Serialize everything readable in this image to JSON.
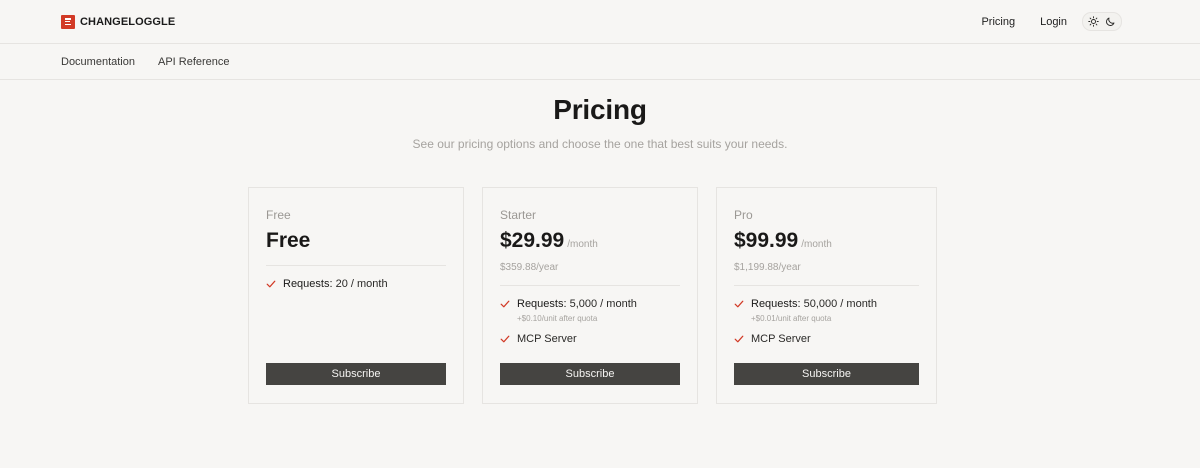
{
  "brand": {
    "name": "CHANGELOGGLE",
    "logo_color": "#d23a26"
  },
  "topnav": {
    "pricing": "Pricing",
    "login": "Login"
  },
  "subnav": {
    "documentation": "Documentation",
    "api_reference": "API Reference"
  },
  "hero": {
    "title": "Pricing",
    "subtitle": "See our pricing options and choose the one that best suits your needs."
  },
  "plans": [
    {
      "name": "Free",
      "price": "Free",
      "per": "",
      "year": "",
      "features": [
        {
          "label": "Requests:",
          "value": "20 / month",
          "note": ""
        }
      ],
      "cta": "Subscribe"
    },
    {
      "name": "Starter",
      "price": "$29.99",
      "per": "/month",
      "year": "$359.88/year",
      "features": [
        {
          "label": "Requests:",
          "value": "5,000 / month",
          "note": "+$0.10/unit after quota"
        },
        {
          "label": "MCP Server",
          "value": "",
          "note": ""
        }
      ],
      "cta": "Subscribe"
    },
    {
      "name": "Pro",
      "price": "$99.99",
      "per": "/month",
      "year": "$1,199.88/year",
      "features": [
        {
          "label": "Requests:",
          "value": "50,000 / month",
          "note": "+$0.01/unit after quota"
        },
        {
          "label": "MCP Server",
          "value": "",
          "note": ""
        }
      ],
      "cta": "Subscribe"
    }
  ],
  "colors": {
    "accent": "#d23a26",
    "button": "#454441",
    "background": "#f7f6f4"
  },
  "icons": {
    "theme_light": "sun-icon",
    "theme_dark": "moon-icon",
    "feature": "check-icon"
  }
}
